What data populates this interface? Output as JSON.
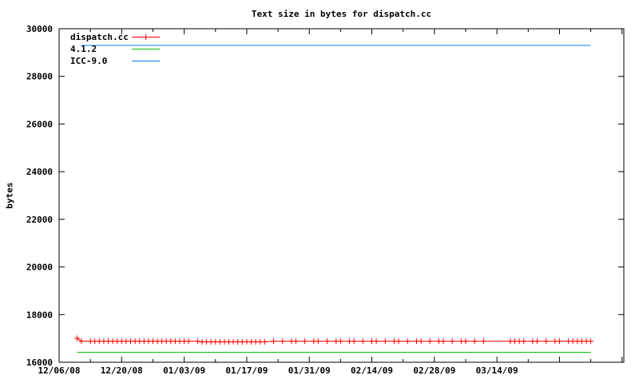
{
  "title": "Text size in bytes for dispatch.cc",
  "ylabel": "bytes",
  "chart_data": {
    "type": "line",
    "title": "Text size in bytes for dispatch.cc",
    "xlabel": "",
    "ylabel": "bytes",
    "ylim": [
      16000,
      30000
    ],
    "xlim_days": [
      0,
      126.4
    ],
    "x_epoch_label": "12/06/08",
    "grid": false,
    "legend_position": "top-left-inside",
    "background_color": "#ffffff",
    "border_color": "#000000",
    "y_ticks": [
      16000,
      18000,
      20000,
      22000,
      24000,
      26000,
      28000,
      30000
    ],
    "x_ticks": [
      {
        "day": 0,
        "major": true,
        "label": "12/06/08"
      },
      {
        "day": 7,
        "major": false
      },
      {
        "day": 14,
        "major": true,
        "label": "12/20/08"
      },
      {
        "day": 21,
        "major": false
      },
      {
        "day": 28,
        "major": true,
        "label": "01/03/09"
      },
      {
        "day": 35,
        "major": false
      },
      {
        "day": 42,
        "major": true,
        "label": "01/17/09"
      },
      {
        "day": 49,
        "major": false
      },
      {
        "day": 56,
        "major": true,
        "label": "01/31/09"
      },
      {
        "day": 63,
        "major": false
      },
      {
        "day": 70,
        "major": true,
        "label": "02/14/09"
      },
      {
        "day": 77,
        "major": false
      },
      {
        "day": 84,
        "major": true,
        "label": "02/28/09"
      },
      {
        "day": 91,
        "major": false
      },
      {
        "day": 98,
        "major": true,
        "label": "03/14/09"
      },
      {
        "day": 105,
        "major": false
      },
      {
        "day": 112,
        "major": true
      },
      {
        "day": 119,
        "major": false
      },
      {
        "day": 126,
        "major": true
      }
    ],
    "series": [
      {
        "name": "dispatch.cc",
        "color": "#ff0000",
        "marker": "plus",
        "points": [
          [
            4,
            17004
          ],
          [
            5,
            16884
          ],
          [
            7,
            16884
          ],
          [
            8,
            16884
          ],
          [
            9,
            16884
          ],
          [
            10,
            16884
          ],
          [
            11,
            16884
          ],
          [
            12,
            16884
          ],
          [
            13,
            16884
          ],
          [
            14,
            16884
          ],
          [
            15,
            16884
          ],
          [
            16,
            16884
          ],
          [
            17,
            16884
          ],
          [
            18,
            16884
          ],
          [
            19,
            16884
          ],
          [
            20,
            16884
          ],
          [
            21,
            16884
          ],
          [
            22,
            16884
          ],
          [
            23,
            16884
          ],
          [
            24,
            16884
          ],
          [
            25,
            16884
          ],
          [
            26,
            16884
          ],
          [
            27,
            16884
          ],
          [
            28,
            16884
          ],
          [
            29,
            16884
          ],
          [
            31,
            16884
          ],
          [
            32,
            16856
          ],
          [
            33,
            16856
          ],
          [
            34,
            16856
          ],
          [
            35,
            16856
          ],
          [
            36,
            16856
          ],
          [
            37,
            16856
          ],
          [
            38,
            16856
          ],
          [
            39,
            16856
          ],
          [
            40,
            16856
          ],
          [
            41,
            16856
          ],
          [
            42,
            16856
          ],
          [
            43,
            16856
          ],
          [
            44,
            16856
          ],
          [
            45,
            16856
          ],
          [
            46,
            16856
          ],
          [
            48,
            16884
          ],
          [
            50,
            16884
          ],
          [
            52,
            16884
          ],
          [
            53,
            16884
          ],
          [
            55,
            16884
          ],
          [
            57,
            16884
          ],
          [
            58,
            16884
          ],
          [
            60,
            16884
          ],
          [
            62,
            16884
          ],
          [
            63,
            16884
          ],
          [
            65,
            16884
          ],
          [
            66,
            16884
          ],
          [
            68,
            16884
          ],
          [
            70,
            16884
          ],
          [
            71,
            16884
          ],
          [
            73,
            16884
          ],
          [
            75,
            16884
          ],
          [
            76,
            16884
          ],
          [
            78,
            16884
          ],
          [
            80,
            16884
          ],
          [
            81,
            16884
          ],
          [
            83,
            16884
          ],
          [
            85,
            16884
          ],
          [
            86,
            16884
          ],
          [
            88,
            16884
          ],
          [
            90,
            16884
          ],
          [
            91,
            16884
          ],
          [
            93,
            16884
          ],
          [
            95,
            16884
          ],
          [
            101,
            16884
          ],
          [
            102,
            16884
          ],
          [
            103,
            16884
          ],
          [
            104,
            16884
          ],
          [
            106,
            16884
          ],
          [
            107,
            16884
          ],
          [
            109,
            16884
          ],
          [
            111,
            16884
          ],
          [
            112,
            16884
          ],
          [
            114,
            16884
          ],
          [
            115,
            16884
          ],
          [
            116,
            16884
          ],
          [
            117,
            16884
          ],
          [
            118,
            16884
          ],
          [
            119,
            16884
          ]
        ]
      },
      {
        "name": "4.1.2",
        "color": "#00c000",
        "marker": "none",
        "points": [
          [
            4,
            16420
          ],
          [
            119,
            16420
          ]
        ]
      },
      {
        "name": "ICC-9.0",
        "color": "#0080ff",
        "marker": "none",
        "points": [
          [
            5,
            29300
          ],
          [
            119,
            29300
          ]
        ]
      }
    ]
  }
}
